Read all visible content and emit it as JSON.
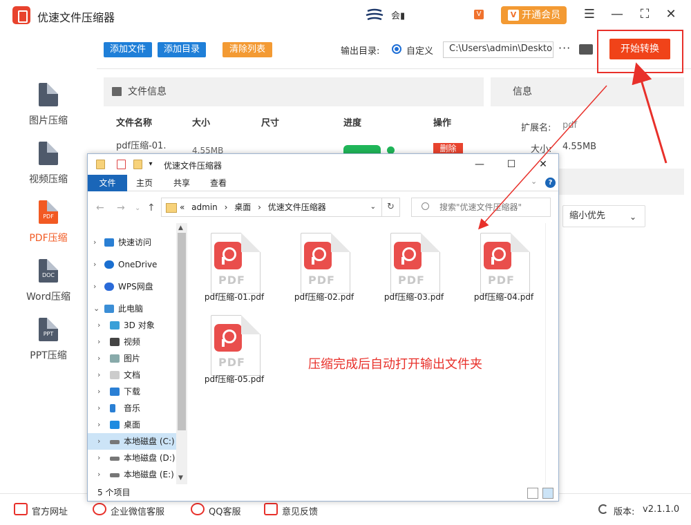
{
  "app": {
    "title": "优速文件压缩器",
    "user_name": "会▮",
    "vip_badge": "V",
    "vip_button": "开通会员",
    "vip_icon": "V"
  },
  "window_controls": {
    "menu": "☰",
    "minimize": "—",
    "maximize": "⛶",
    "close": "✕"
  },
  "sidebar": {
    "items": [
      {
        "label": "图片压缩",
        "icon_text": "",
        "icon": "image-file-icon"
      },
      {
        "label": "视频压缩",
        "icon_text": "",
        "icon": "video-file-icon"
      },
      {
        "label": "PDF压缩",
        "icon_text": "PDF",
        "icon": "pdf-file-icon",
        "active": true
      },
      {
        "label": "Word压缩",
        "icon_text": "DOC",
        "icon": "word-file-icon"
      },
      {
        "label": "PPT压缩",
        "icon_text": "PPT",
        "icon": "ppt-file-icon"
      }
    ]
  },
  "toolbar": {
    "add_file": "添加文件",
    "add_dir": "添加目录",
    "clear_list": "清除列表",
    "output_label": "输出目录:",
    "radio_custom": "自定义",
    "output_path": "C:\\Users\\admin\\Desktop",
    "more": "···",
    "start": "开始转换"
  },
  "file_panel": {
    "title": "文件信息",
    "columns": [
      "文件名称",
      "大小",
      "尺寸",
      "进度",
      "操作"
    ],
    "rows": [
      {
        "name": "pdf压缩-01.",
        "size": "4.55MB",
        "dim": "-",
        "action": "删除"
      }
    ]
  },
  "info_panel": {
    "title": "信息",
    "ext_label": "扩展名:",
    "ext_value": "pdf",
    "size_label": "大小:",
    "size_value": "4.55MB",
    "mode_select": "缩小优先"
  },
  "statusbar": {
    "items": [
      "官方网址",
      "企业微信客服",
      "QQ客服",
      "意见反馈"
    ],
    "version_label": "版本:",
    "version_value": "v2.1.1.0"
  },
  "explorer": {
    "title": "优速文件压缩器",
    "ribbon_tabs": [
      "文件",
      "主页",
      "共享",
      "查看"
    ],
    "breadcrumb": [
      "«",
      "admin",
      "›",
      "桌面",
      "›",
      "优速文件压缩器"
    ],
    "search_placeholder": "搜索\"优速文件压缩器\"",
    "nav": [
      {
        "label": "快速访问",
        "level": 0,
        "icon": "star-icon"
      },
      {
        "label": "OneDrive",
        "level": 0,
        "icon": "cloud-icon"
      },
      {
        "label": "WPS网盘",
        "level": 0,
        "icon": "cloud-icon"
      },
      {
        "label": "此电脑",
        "level": 0,
        "icon": "computer-icon",
        "expanded": true
      },
      {
        "label": "3D 对象",
        "level": 1,
        "icon": "cube-icon"
      },
      {
        "label": "视频",
        "level": 1,
        "icon": "film-icon"
      },
      {
        "label": "图片",
        "level": 1,
        "icon": "picture-icon"
      },
      {
        "label": "文档",
        "level": 1,
        "icon": "document-icon"
      },
      {
        "label": "下载",
        "level": 1,
        "icon": "download-icon"
      },
      {
        "label": "音乐",
        "level": 1,
        "icon": "music-icon"
      },
      {
        "label": "桌面",
        "level": 1,
        "icon": "desktop-icon"
      },
      {
        "label": "本地磁盘 (C:)",
        "level": 1,
        "icon": "drive-icon",
        "selected": true
      },
      {
        "label": "本地磁盘 (D:)",
        "level": 1,
        "icon": "drive-icon"
      },
      {
        "label": "本地磁盘 (E:)",
        "level": 1,
        "icon": "drive-icon"
      }
    ],
    "files": [
      {
        "name": "pdf压缩-01.pdf"
      },
      {
        "name": "pdf压缩-02.pdf"
      },
      {
        "name": "pdf压缩-03.pdf"
      },
      {
        "name": "pdf压缩-04.pdf"
      },
      {
        "name": "pdf压缩-05.pdf"
      }
    ],
    "file_icon_text": "PDF",
    "status": "5 个项目"
  },
  "annotation": "压缩完成后自动打开输出文件夹",
  "colors": {
    "accent": "#f04319",
    "blue": "#1f7fd8",
    "highlight": "#e8302a"
  }
}
